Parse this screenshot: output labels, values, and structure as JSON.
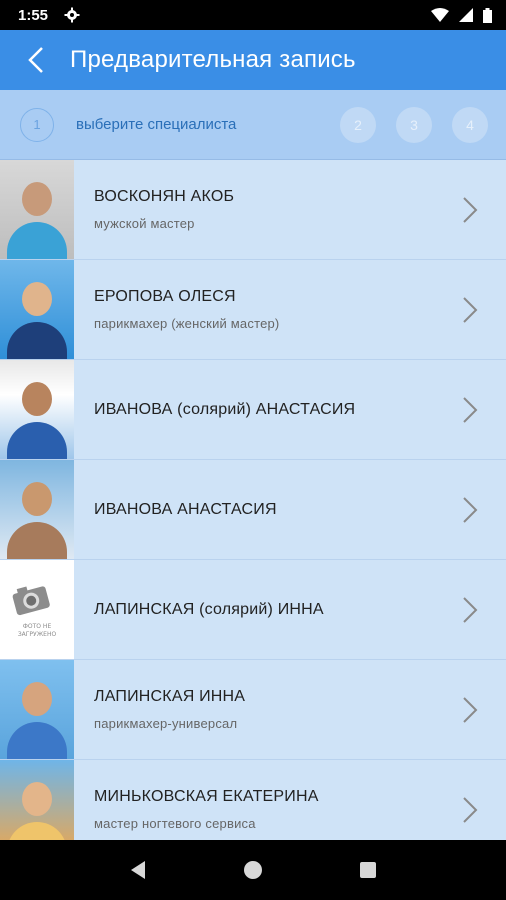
{
  "status": {
    "time": "1:55"
  },
  "appbar": {
    "title": "Предварительная запись"
  },
  "stepper": {
    "active_step": "1",
    "active_label": "выберите специалиста",
    "steps": [
      "2",
      "3",
      "4"
    ]
  },
  "specialists": [
    {
      "name": "ВОСКОНЯН АКОБ",
      "role": "мужской мастер"
    },
    {
      "name": "ЕРОПОВА ОЛЕСЯ",
      "role": "парикмахер (женский мастер)"
    },
    {
      "name": "ИВАНОВА (солярий) АНАСТАСИЯ",
      "role": ""
    },
    {
      "name": "ИВАНОВА АНАСТАСИЯ",
      "role": ""
    },
    {
      "name": "ЛАПИНСКАЯ (солярий) ИННА",
      "role": ""
    },
    {
      "name": "ЛАПИНСКАЯ ИННА",
      "role": "парикмахер-универсал"
    },
    {
      "name": "МИНЬКОВСКАЯ ЕКАТЕРИНА",
      "role": "мастер ногтевого сервиса"
    }
  ],
  "placeholder_photo_text": "ФОТО НЕ ЗАГРУЖЕНО",
  "colors": {
    "appbar": "#3a8ee6",
    "background": "#cfe3f7",
    "stepper": "#a9ccf3"
  }
}
